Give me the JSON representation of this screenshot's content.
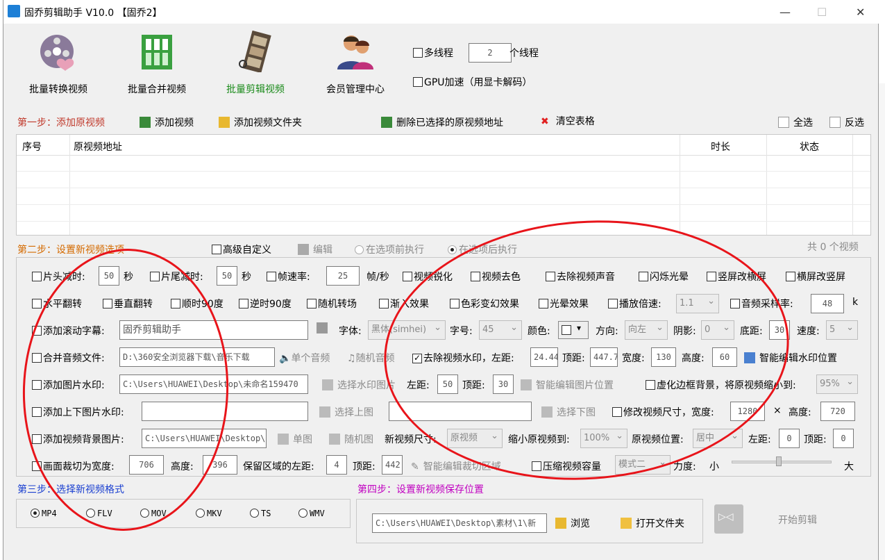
{
  "title": "固乔剪辑助手 V10.0 【固乔2】",
  "toolbar": {
    "batch_convert": "批量转换视频",
    "batch_merge": "批量合并视频",
    "batch_edit": "批量剪辑视频",
    "member": "会员管理中心",
    "multithread": "多线程",
    "thread_count": "2",
    "thread_unit": "个线程",
    "gpu": "GPU加速（用显卡解码）"
  },
  "step1": {
    "label": "第一步：添加原视频",
    "add_video": "添加视频",
    "add_folder": "添加视频文件夹",
    "delete_selected": "删除已选择的原视频地址",
    "clear_table": "清空表格",
    "select_all": "全选",
    "invert": "反选",
    "columns": [
      "序号",
      "原视频地址",
      "时长",
      "状态"
    ]
  },
  "step2": {
    "label": "第二步：设置新视频选项",
    "advanced": "高级自定义",
    "edit": "编辑",
    "before": "在选项前执行",
    "after": "在选项后执行",
    "count": "共 0 个视频",
    "r1": {
      "head_cut": "片头减时:",
      "head_val": "50",
      "sec1": "秒",
      "tail_cut": "片尾减时:",
      "tail_val": "50",
      "sec2": "秒",
      "fps": "帧速率:",
      "fps_val": "25",
      "fps_unit": "帧/秒",
      "sharpen": "视频锐化",
      "decolor": "视频去色",
      "remove_audio": "去除视频声音",
      "flash": "闪烁光晕",
      "h2v": "竖屏改横屏",
      "v2h": "横屏改竖屏"
    },
    "r2": {
      "hflip": "水平翻转",
      "vflip": "垂直翻转",
      "cw90": "顺时90度",
      "ccw90": "逆时90度",
      "random_trans": "随机转场",
      "fade": "渐入效果",
      "color_fx": "色彩变幻效果",
      "glow": "光晕效果",
      "speed": "播放倍速:",
      "speed_val": "1.1",
      "samplerate": "音频采样率:",
      "samplerate_val": "48",
      "k": "k"
    },
    "r3": {
      "scroll": "添加滚动字幕:",
      "scroll_text": "固乔剪辑助手",
      "font": "字体:",
      "font_val": "黑体(simhei)",
      "size": "字号:",
      "size_val": "45",
      "color": "颜色:",
      "dir": "方向:",
      "dir_val": "向左",
      "shadow": "阴影:",
      "shadow_val": "0",
      "bottom": "底距:",
      "bottom_val": "30",
      "spd": "速度:",
      "spd_val": "5"
    },
    "r4": {
      "merge_audio": "合并音频文件:",
      "audio_path": "D:\\360安全浏览器下载\\音乐下载",
      "single_audio": "单个音频",
      "random_audio": "随机音频",
      "remove_wm": "去除视频水印，左距:",
      "wm_left": "24.44",
      "wm_top_label": "顶距:",
      "wm_top": "447.7",
      "wm_w_label": "宽度:",
      "wm_w": "130",
      "wm_h_label": "高度:",
      "wm_h": "60",
      "smart_wm": "智能编辑水印位置"
    },
    "r5": {
      "img_wm": "添加图片水印:",
      "img_path": "C:\\Users\\HUAWEI\\Desktop\\未命名159470",
      "choose_img": "选择水印图片",
      "left": "左距:",
      "left_val": "50",
      "top": "顶距:",
      "top_val": "30",
      "smart_img": "智能编辑图片位置",
      "blur_bg": "虚化边框背景，将原视频缩小到:",
      "blur_val": "95%"
    },
    "r6": {
      "updown": "添加上下图片水印:",
      "choose_up": "选择上图",
      "choose_down": "选择下图",
      "resize": "修改视频尺寸，宽度:",
      "width_val": "1280",
      "x": "×",
      "height": "高度:",
      "height_val": "720"
    },
    "r7": {
      "bg_img": "添加视频背景图片:",
      "bg_path": "C:\\Users\\HUAWEI\\Desktop\\",
      "single": "单图",
      "random": "随机图",
      "new_size": "新视频尺寸:",
      "new_size_val": "原视频",
      "shrink": "缩小原视频到:",
      "shrink_val": "100%",
      "pos": "原视频位置:",
      "pos_val": "居中",
      "left": "左距:",
      "left_val": "0",
      "top": "顶距:",
      "top_val": "0"
    },
    "r8": {
      "crop": "画面裁切为宽度:",
      "crop_w": "706",
      "h": "高度:",
      "crop_h": "396",
      "keep_left": "保留区域的左距:",
      "keep_left_val": "4",
      "top": "顶距:",
      "top_val": "442",
      "smart_crop": "智能编辑裁切区域",
      "compress": "压缩视频容量",
      "mode": "模式二",
      "strength": "力度:",
      "small": "小",
      "large": "大"
    }
  },
  "step3": {
    "label": "第三步：选择新视频格式",
    "formats": [
      "MP4",
      "FLV",
      "MOV",
      "MKV",
      "TS",
      "WMV"
    ],
    "selected": "MP4"
  },
  "step4": {
    "label": "第四步：设置新视频保存位置",
    "path": "C:\\Users\\HUAWEI\\Desktop\\素材\\1\\新",
    "browse": "浏览",
    "open_folder": "打开文件夹",
    "start": "开始剪辑"
  },
  "colors": {
    "red_circle": "#e8141a",
    "step1": "#c0392b",
    "step2": "#d46a00",
    "step3": "#1a3fd0",
    "step4": "#c000c0"
  }
}
